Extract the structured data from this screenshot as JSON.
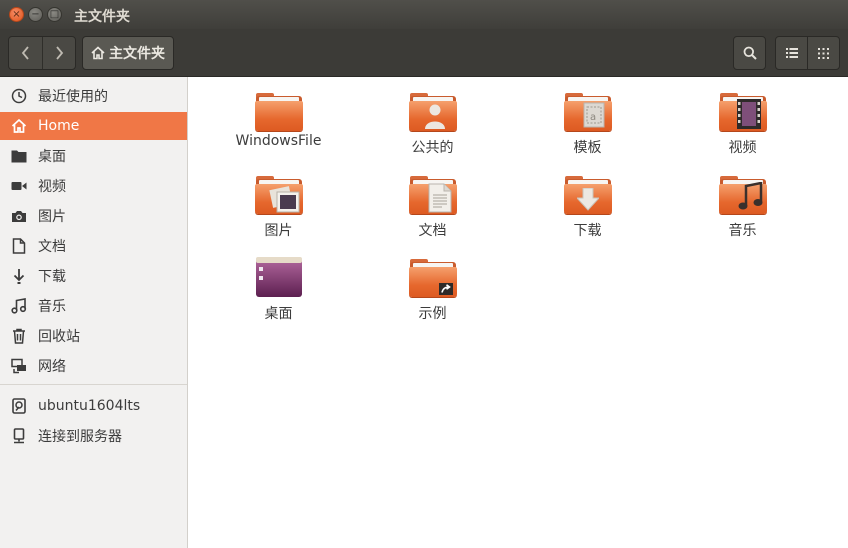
{
  "window": {
    "title": "主文件夹",
    "close_glyph": "×",
    "min_glyph": "−",
    "max_glyph": "□"
  },
  "toolbar": {
    "back_icon": "chevron-left-icon",
    "forward_icon": "chevron-right-icon",
    "path_label": "主文件夹",
    "search_icon": "search-icon",
    "list_view_icon": "list-view-icon",
    "grid_view_icon": "grid-view-icon"
  },
  "sidebar": {
    "items": [
      {
        "label": "最近使用的",
        "icon": "clock-icon"
      },
      {
        "label": "Home",
        "icon": "home-icon",
        "active": true
      },
      {
        "label": "桌面",
        "icon": "desktop-folder-icon"
      },
      {
        "label": "视频",
        "icon": "video-icon"
      },
      {
        "label": "图片",
        "icon": "camera-icon"
      },
      {
        "label": "文档",
        "icon": "document-icon"
      },
      {
        "label": "下载",
        "icon": "download-icon"
      },
      {
        "label": "音乐",
        "icon": "music-icon"
      },
      {
        "label": "回收站",
        "icon": "trash-icon"
      },
      {
        "label": "网络",
        "icon": "network-icon"
      },
      {
        "label": "ubuntu1604lts",
        "icon": "drive-icon"
      },
      {
        "label": "连接到服务器",
        "icon": "server-icon"
      }
    ]
  },
  "files": [
    {
      "label": "WindowsFile",
      "icon": "folder-icon"
    },
    {
      "label": "公共的",
      "icon": "folder-public-icon"
    },
    {
      "label": "模板",
      "icon": "folder-templates-icon"
    },
    {
      "label": "视频",
      "icon": "folder-videos-icon"
    },
    {
      "label": "图片",
      "icon": "folder-pictures-icon"
    },
    {
      "label": "文档",
      "icon": "folder-documents-icon"
    },
    {
      "label": "下载",
      "icon": "folder-download-icon"
    },
    {
      "label": "音乐",
      "icon": "folder-music-icon"
    },
    {
      "label": "桌面",
      "icon": "desktop-icon"
    },
    {
      "label": "示例",
      "icon": "folder-link-icon"
    }
  ],
  "colors": {
    "accent": "#f07746",
    "titlebar": "#3c3b37",
    "folder": "#e6682e"
  }
}
